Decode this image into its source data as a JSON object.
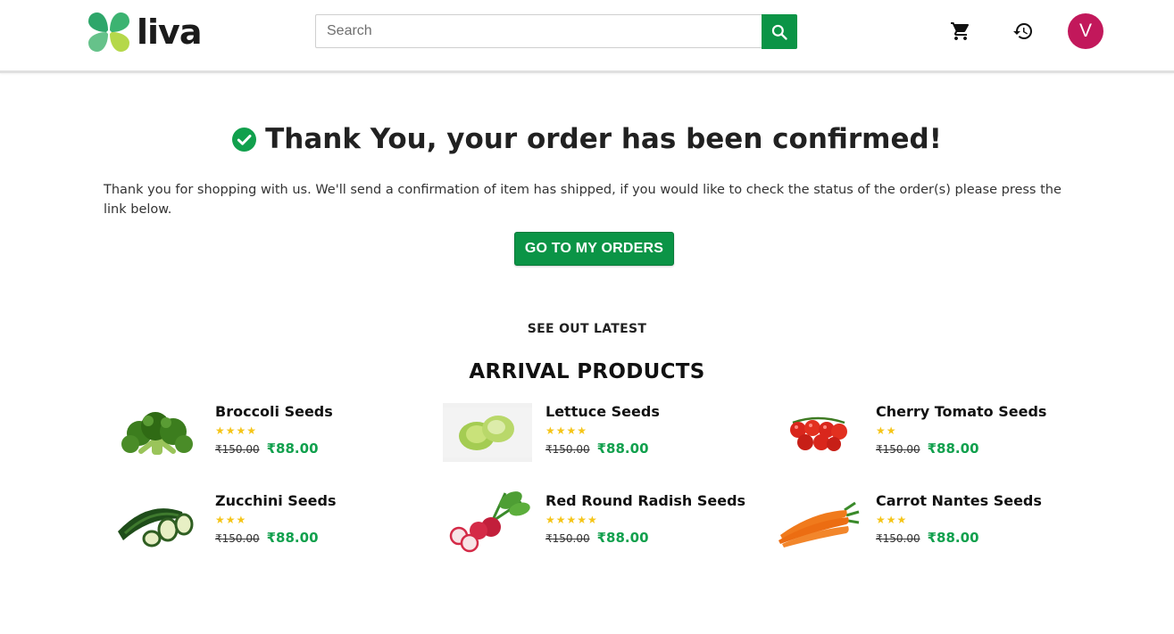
{
  "header": {
    "logo_text": "liva",
    "search_placeholder": "Search",
    "avatar_initial": "V"
  },
  "main": {
    "title": "Thank You, your order has been confirmed!",
    "message": "Thank you for shopping with us. We'll send a confirmation of item has shipped, if you would like to check the status of the order(s) please press the link below.",
    "orders_button": "GO TO MY ORDERS",
    "sub_heading": "SEE OUT LATEST",
    "section_heading": "ARRIVAL PRODUCTS"
  },
  "products": [
    {
      "name": "Broccoli Seeds",
      "stars": "★★★★",
      "rating": 4,
      "old_price": "₹150.00",
      "new_price": "₹88.00",
      "image": "broccoli"
    },
    {
      "name": "Lettuce Seeds",
      "stars": "★★★★",
      "rating": 4,
      "old_price": "₹150.00",
      "new_price": "₹88.00",
      "image": "lettuce"
    },
    {
      "name": "Cherry Tomato Seeds",
      "stars": "★★",
      "rating": 2,
      "old_price": "₹150.00",
      "new_price": "₹88.00",
      "image": "cherry-tomato"
    },
    {
      "name": "Zucchini Seeds",
      "stars": "★★★",
      "rating": 3,
      "old_price": "₹150.00",
      "new_price": "₹88.00",
      "image": "zucchini"
    },
    {
      "name": "Red Round Radish Seeds",
      "stars": "★★★★★",
      "rating": 5,
      "old_price": "₹150.00",
      "new_price": "₹88.00",
      "image": "radish"
    },
    {
      "name": "Carrot Nantes Seeds",
      "stars": "★★★",
      "rating": 3,
      "old_price": "₹150.00",
      "new_price": "₹88.00",
      "image": "carrot"
    }
  ],
  "colors": {
    "brand_green": "#0b9446",
    "price_green": "#11a04d",
    "avatar": "#c2185b",
    "star": "#f5c518"
  },
  "icons": {
    "search": "search-icon",
    "cart": "cart-icon",
    "history": "history-icon",
    "check": "check-circle-icon"
  }
}
